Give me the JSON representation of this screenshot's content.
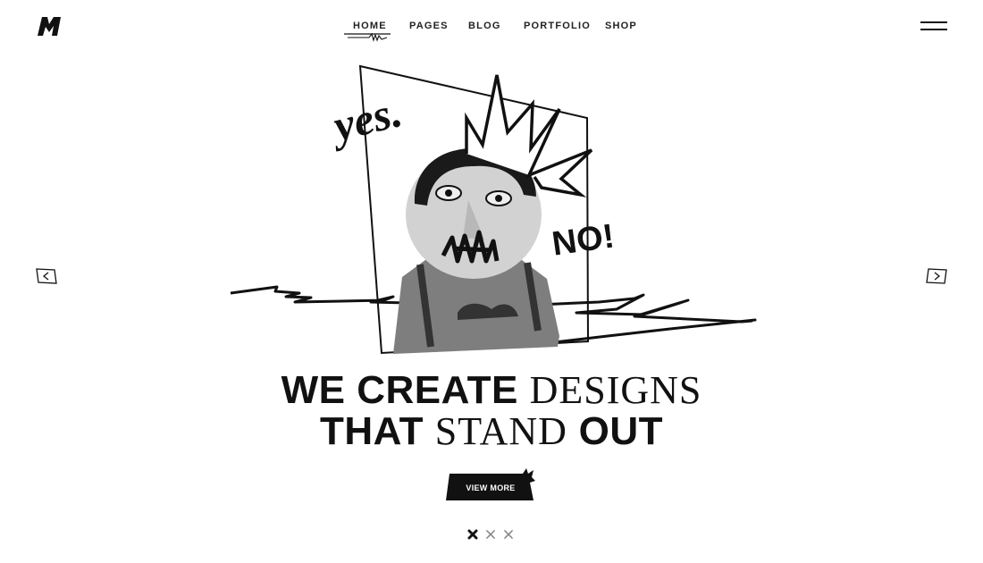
{
  "brand": {
    "logo_letter": "M"
  },
  "nav": {
    "items": [
      {
        "label": "HOME",
        "active": true
      },
      {
        "label": "PAGES",
        "active": false
      },
      {
        "label": "BLOG",
        "active": false
      },
      {
        "label": "PORTFOLIO",
        "active": false
      },
      {
        "label": "SHOP",
        "active": false
      }
    ]
  },
  "hero": {
    "art_text_yes": "yes.",
    "art_text_no": "NO!",
    "headline": {
      "line1_bold": "WE CREATE",
      "line1_serif": "DESIGNS",
      "line2_bold_a": "THAT",
      "line2_serif": "STAND",
      "line2_bold_b": "OUT"
    },
    "cta_label": "VIEW MORE"
  },
  "slider": {
    "active_index": 0,
    "count": 3,
    "prev_icon": "chevron-left-icon",
    "next_icon": "chevron-right-icon"
  },
  "colors": {
    "ink": "#111111",
    "background": "#ffffff"
  }
}
